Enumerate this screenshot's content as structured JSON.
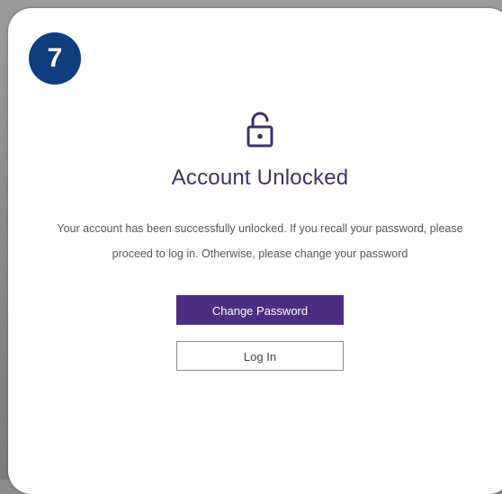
{
  "step": {
    "number": "7",
    "color": "#103d7e"
  },
  "icon": {
    "name": "unlocked-padlock-icon",
    "color": "#40306b"
  },
  "title": "Account Unlocked",
  "message": {
    "line1": "Your account has been successfully unlocked. If you recall your password, please",
    "line2": "proceed to log in. Otherwise, please change your password"
  },
  "buttons": {
    "change_password": "Change Password",
    "log_in": "Log In"
  },
  "colors": {
    "primary": "#4b2e7f",
    "title": "#40306b"
  }
}
